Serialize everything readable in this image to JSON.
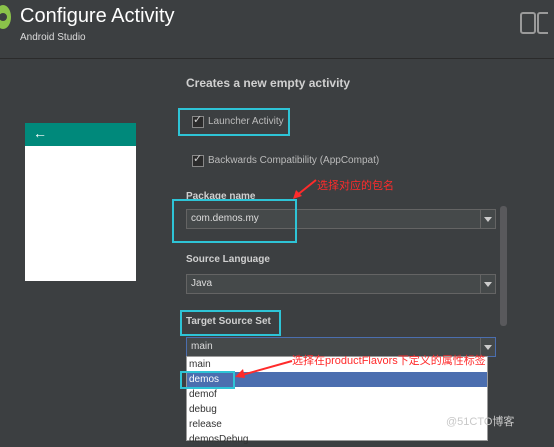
{
  "window": {
    "title": "Configure Activity",
    "subtitle": "Android Studio"
  },
  "heading": "Creates a new empty activity",
  "options": {
    "launcher": {
      "label": "Launcher Activity",
      "checked": true
    },
    "backwards": {
      "label": "Backwards Compatibility (AppCompat)",
      "checked": true
    }
  },
  "package": {
    "label": "Package name",
    "value": "com.demos.my"
  },
  "source_language": {
    "label": "Source Language",
    "value": "Java"
  },
  "target_source_set": {
    "label": "Target Source Set",
    "value": "main",
    "options": [
      "main",
      "demos",
      "demof",
      "debug",
      "release",
      "demosDebug"
    ],
    "selected": "demos"
  },
  "annotations": {
    "package_note": "选择对应的包名",
    "flavor_note": "选择在productFlavors下定义的属性标签"
  },
  "watermark": "@51CTO博客",
  "colors": {
    "accent_highlight": "#2ec4d6",
    "preview_toolbar": "#00897b",
    "selection": "#4b6eaf",
    "annotation": "#ff2b2b"
  }
}
